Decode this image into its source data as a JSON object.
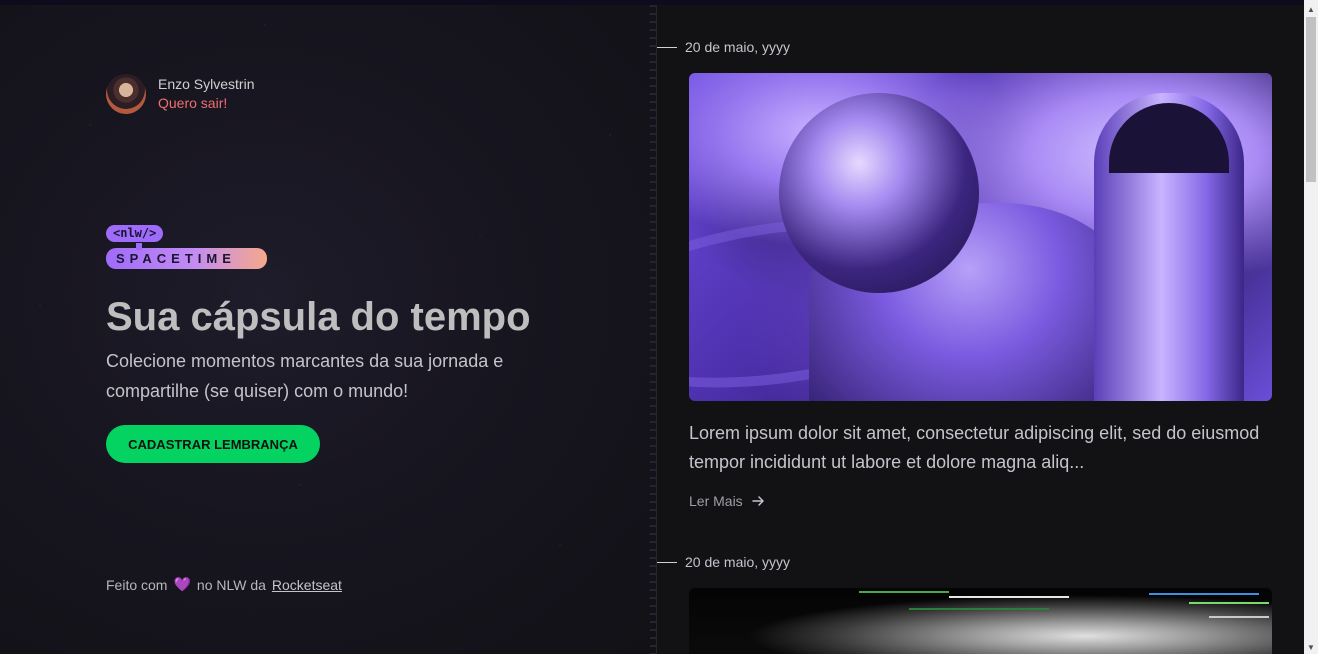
{
  "user": {
    "name": "Enzo Sylvestrin",
    "logout_label": "Quero sair!"
  },
  "logo": {
    "tag": "<nlw/>",
    "text": "SPACETIME"
  },
  "hero": {
    "title": "Sua cápsula do tempo",
    "subtitle": "Colecione momentos marcantes da sua jornada e compartilhe (se quiser) com o mundo!",
    "cta_label": "CADASTRAR LEMBRANÇA"
  },
  "footer": {
    "prefix": "Feito com",
    "heart_icon": "heart-icon",
    "middle": "no NLW da",
    "link": "Rocketseat"
  },
  "memories": [
    {
      "date": "20 de maio, yyyy",
      "excerpt": "Lorem ipsum dolor sit amet, consectetur adipiscing elit, sed do eiusmod tempor incididunt ut labore et dolore magna aliq...",
      "read_more": "Ler Mais"
    },
    {
      "date": "20 de maio, yyyy"
    }
  ],
  "colors": {
    "accent_green": "#04d361",
    "accent_purple": "#9f6bfa",
    "logout_red": "#ef6f6f",
    "background": "#121215"
  }
}
